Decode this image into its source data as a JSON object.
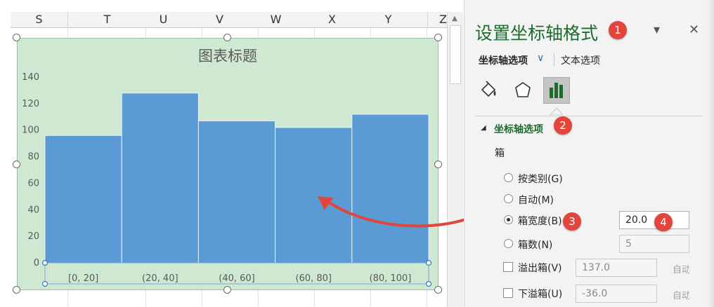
{
  "spreadsheet": {
    "columns": [
      "S",
      "T",
      "U",
      "V",
      "W",
      "X",
      "Y",
      "Z"
    ]
  },
  "chart_data": {
    "type": "bar",
    "title": "图表标题",
    "categories": [
      "[0, 20]",
      "(20, 40]",
      "(40, 60]",
      "(60, 80]",
      "(80, 100]"
    ],
    "values": [
      96,
      128,
      107,
      102,
      112
    ],
    "yticks": [
      0,
      20,
      40,
      60,
      80,
      100,
      120,
      140
    ],
    "ylim": [
      0,
      140
    ],
    "grid": false,
    "colors": {
      "bar": "#5b9bd5",
      "plot_background": "#cfe8d2"
    }
  },
  "panel": {
    "title": "设置坐标轴格式",
    "tabs": {
      "active": "坐标轴选项",
      "other": "文本选项"
    },
    "icons": [
      "fill-line-icon",
      "effects-pentagon-icon",
      "axis-options-bar-chart-icon"
    ],
    "section_title": "坐标轴选项",
    "box_label": "箱",
    "radio_options": [
      {
        "label": "按类别(G)",
        "checked": false
      },
      {
        "label": "自动(M)",
        "checked": false
      },
      {
        "label": "箱宽度(B)",
        "checked": true
      },
      {
        "label": "箱数(N)",
        "checked": false
      }
    ],
    "bin_width_value": "20.0",
    "bin_count_value": "5",
    "overflow": {
      "label": "溢出箱(V)",
      "value": "137.0",
      "auto": "自动"
    },
    "underflow": {
      "label": "下溢箱(U)",
      "value": "-36.0",
      "auto": "自动"
    }
  },
  "annotations": {
    "badges": [
      "1",
      "2",
      "3",
      "4"
    ],
    "colors": {
      "badge": "#e2453c",
      "arrow": "#e2453c"
    }
  }
}
